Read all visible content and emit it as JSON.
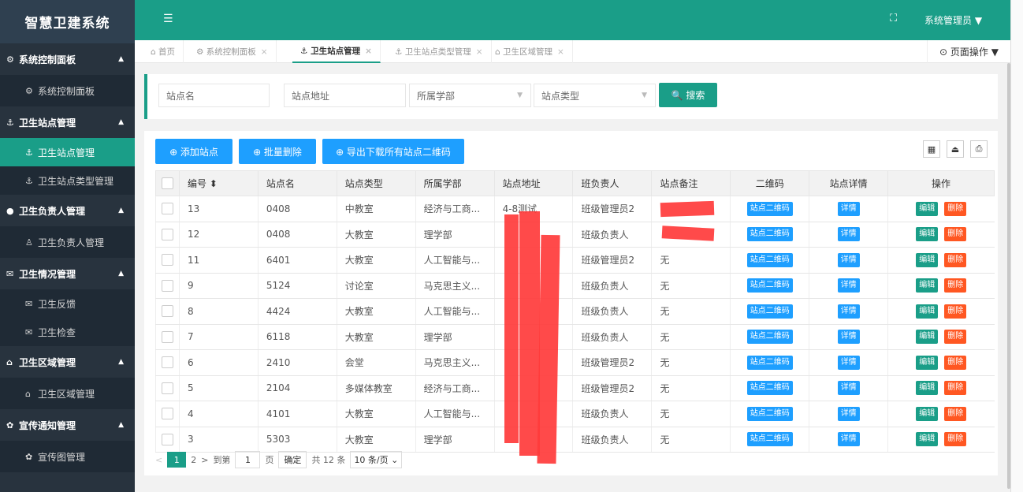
{
  "app": {
    "title": "智慧卫建系统"
  },
  "header": {
    "menu_icon": "☰",
    "fullscreen_icon": "⛶",
    "user": "系统管理员 ▼"
  },
  "sidebar": {
    "groups": [
      {
        "label": "系统控制面板",
        "icon": "⚙",
        "items": [
          {
            "label": "系统控制面板",
            "icon": "⚙"
          }
        ]
      },
      {
        "label": "卫生站点管理",
        "icon": "⚓",
        "items": [
          {
            "label": "卫生站点管理",
            "icon": "⚓"
          },
          {
            "label": "卫生站点类型管理",
            "icon": "⚓"
          }
        ]
      },
      {
        "label": "卫生负责人管理",
        "icon": "●",
        "items": [
          {
            "label": "卫生负责人管理",
            "icon": "♙"
          }
        ]
      },
      {
        "label": "卫生情况管理",
        "icon": "✉",
        "items": [
          {
            "label": "卫生反馈",
            "icon": "✉"
          },
          {
            "label": "卫生检查",
            "icon": "✉"
          }
        ]
      },
      {
        "label": "卫生区域管理",
        "icon": "⌂",
        "items": [
          {
            "label": "卫生区域管理",
            "icon": "⌂"
          }
        ]
      },
      {
        "label": "宣传通知管理",
        "icon": "✿",
        "items": [
          {
            "label": "宣传图管理",
            "icon": "✿"
          }
        ]
      }
    ]
  },
  "tabs": [
    {
      "label": "⌂ 首页"
    },
    {
      "label": "⚙ 系统控制面板",
      "close": "×"
    },
    {
      "label": "⚓ 卫生站点管理",
      "close": "×"
    },
    {
      "label": "⚓ 卫生站点类型管理",
      "close": "×"
    },
    {
      "label": "⌂ 卫生区域管理",
      "close": "×"
    }
  ],
  "page_op": "⊙ 页面操作 ▼",
  "search": {
    "name_placeholder": "站点名",
    "address_placeholder": "站点地址",
    "dept_placeholder": "所属学部",
    "type_placeholder": "站点类型",
    "button": "🔍 搜索"
  },
  "toolbar": {
    "add": "⊕ 添加站点",
    "batch_delete": "⊕ 批量删除",
    "export": "⊕ 导出下载所有站点二维码",
    "tools": [
      "▦",
      "⏏",
      "⎙"
    ]
  },
  "table": {
    "headers": [
      "编号 ⬍",
      "站点名",
      "站点类型",
      "所属学部",
      "站点地址",
      "班负责人",
      "站点备注",
      "二维码",
      "站点详情",
      "操作"
    ],
    "qr_label": "站点二维码",
    "detail_label": "详情",
    "edit_label": "编辑",
    "delete_label": "删除",
    "rows": [
      {
        "id": "13",
        "name": "0408",
        "type": "中教室",
        "dept": "经济与工商...",
        "addr": "4-8测试",
        "owner": "班级管理员2",
        "note": ""
      },
      {
        "id": "12",
        "name": "0408",
        "type": "大教室",
        "dept": "理学部",
        "addr": "",
        "owner": "班级负责人",
        "note": ""
      },
      {
        "id": "11",
        "name": "6401",
        "type": "大教室",
        "dept": "人工智能与...",
        "addr": "",
        "owner": "班级管理员2",
        "note": "无"
      },
      {
        "id": "9",
        "name": "5124",
        "type": "讨论室",
        "dept": "马克思主义...",
        "addr": "",
        "owner": "班级负责人",
        "note": "无"
      },
      {
        "id": "8",
        "name": "4424",
        "type": "大教室",
        "dept": "人工智能与...",
        "addr": "",
        "owner": "班级负责人",
        "note": "无"
      },
      {
        "id": "7",
        "name": "6118",
        "type": "大教室",
        "dept": "理学部",
        "addr": "",
        "owner": "班级负责人",
        "note": "无"
      },
      {
        "id": "6",
        "name": "2410",
        "type": "会堂",
        "dept": "马克思主义...",
        "addr": "",
        "owner": "班级管理员2",
        "note": "无"
      },
      {
        "id": "5",
        "name": "2104",
        "type": "多媒体教室",
        "dept": "经济与工商...",
        "addr": "",
        "owner": "班级管理员2",
        "note": "无"
      },
      {
        "id": "4",
        "name": "4101",
        "type": "大教室",
        "dept": "人工智能与...",
        "addr": "",
        "owner": "班级负责人",
        "note": "无"
      },
      {
        "id": "3",
        "name": "5303",
        "type": "大教室",
        "dept": "理学部",
        "addr": "",
        "owner": "班级负责人",
        "note": "无"
      }
    ]
  },
  "pager": {
    "prev": "<",
    "current": "1",
    "next_page": "2",
    "next": ">",
    "goto": "到第",
    "page_value": "1",
    "page_unit": "页",
    "confirm": "确定",
    "total": "共 12 条",
    "page_size": "10 条/页 ⌄"
  }
}
